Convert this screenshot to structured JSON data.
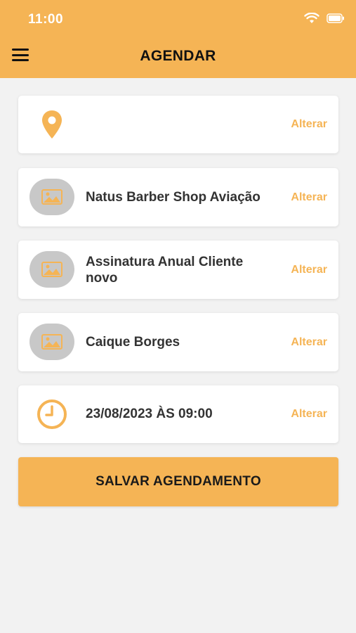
{
  "status_bar": {
    "time": "11:00"
  },
  "header": {
    "title": "AGENDAR"
  },
  "cards": [
    {
      "text": "",
      "action": "Alterar",
      "icon": "location-pin-icon"
    },
    {
      "text": "Natus Barber Shop Aviação",
      "action": "Alterar",
      "icon": "image-placeholder-icon"
    },
    {
      "text": "Assinatura Anual Cliente novo",
      "action": "Alterar",
      "icon": "image-placeholder-icon"
    },
    {
      "text": "Caique Borges",
      "action": "Alterar",
      "icon": "image-placeholder-icon"
    },
    {
      "text": "23/08/2023 ÀS 09:00",
      "action": "Alterar",
      "icon": "clock-icon"
    }
  ],
  "save_button": {
    "label": "SALVAR AGENDAMENTO"
  },
  "colors": {
    "accent": "#f5b455",
    "background": "#f2f2f2",
    "avatar_bg": "#c8c8c8"
  }
}
